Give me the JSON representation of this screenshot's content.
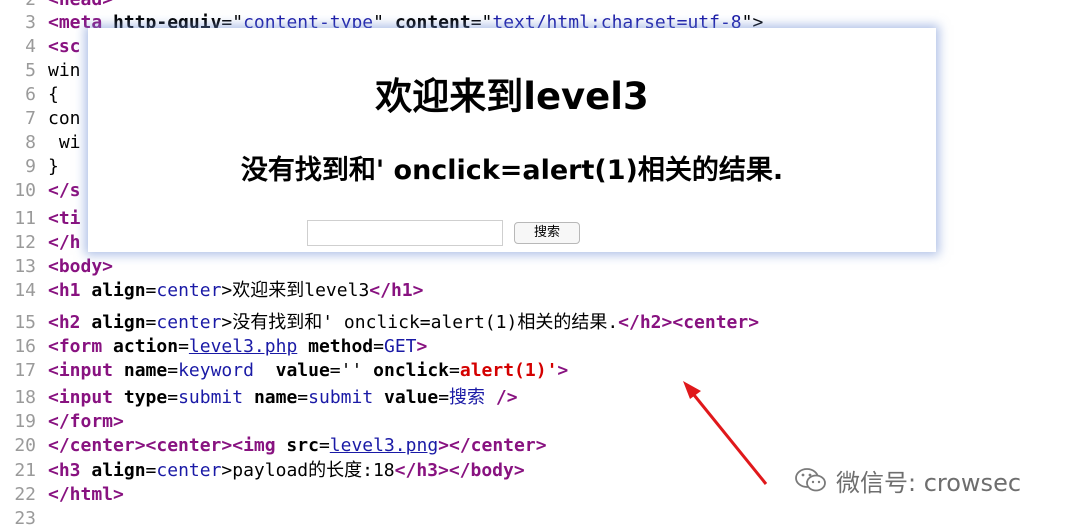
{
  "source_lines": [
    {
      "num": "2",
      "parts": [
        {
          "t": "<",
          "c": "tag"
        },
        {
          "t": "head",
          "c": "tag"
        },
        {
          "t": ">",
          "c": "tag"
        }
      ]
    },
    {
      "num": "3",
      "parts": [
        {
          "t": "<meta ",
          "c": "tag"
        },
        {
          "t": "http-equiv",
          "c": "attr"
        },
        {
          "t": "=\"",
          "c": ""
        },
        {
          "t": "content-type",
          "c": "val"
        },
        {
          "t": "\" ",
          "c": ""
        },
        {
          "t": "content",
          "c": "attr"
        },
        {
          "t": "=\"",
          "c": ""
        },
        {
          "t": "text/html;charset=utf-8",
          "c": "val"
        },
        {
          "t": "\">",
          "c": ""
        }
      ]
    },
    {
      "num": "4",
      "parts": [
        {
          "t": "<sc",
          "c": "tag"
        }
      ]
    },
    {
      "num": "5",
      "parts": [
        {
          "t": "win",
          "c": ""
        }
      ]
    },
    {
      "num": "6",
      "parts": [
        {
          "t": "{",
          "c": ""
        }
      ]
    },
    {
      "num": "7",
      "parts": [
        {
          "t": "con",
          "c": ""
        }
      ]
    },
    {
      "num": "8",
      "parts": [
        {
          "t": " wi",
          "c": ""
        }
      ]
    },
    {
      "num": "9",
      "parts": [
        {
          "t": "}",
          "c": ""
        }
      ]
    },
    {
      "num": "10",
      "parts": [
        {
          "t": "</s",
          "c": "tag"
        }
      ]
    },
    {
      "num": "11",
      "parts": [
        {
          "t": "<ti",
          "c": "tag"
        }
      ]
    },
    {
      "num": "12",
      "parts": [
        {
          "t": "</h",
          "c": "tag"
        }
      ]
    },
    {
      "num": "13",
      "parts": [
        {
          "t": "<body>",
          "c": "tag"
        }
      ]
    },
    {
      "num": "14",
      "parts": [
        {
          "t": "<h1 ",
          "c": "tag"
        },
        {
          "t": "align",
          "c": "attr"
        },
        {
          "t": "=",
          "c": ""
        },
        {
          "t": "center",
          "c": "val"
        },
        {
          "t": ">欢迎来到level3",
          "c": ""
        },
        {
          "t": "</h1>",
          "c": "tag"
        }
      ]
    },
    {
      "num": "15",
      "parts": [
        {
          "t": "<h2 ",
          "c": "tag"
        },
        {
          "t": "align",
          "c": "attr"
        },
        {
          "t": "=",
          "c": ""
        },
        {
          "t": "center",
          "c": "val"
        },
        {
          "t": ">没有找到和' onclick=alert(1)相关的结果.",
          "c": ""
        },
        {
          "t": "</h2><center>",
          "c": "tag"
        }
      ]
    },
    {
      "num": "16",
      "parts": [
        {
          "t": "<form ",
          "c": "tag"
        },
        {
          "t": "action",
          "c": "attr"
        },
        {
          "t": "=",
          "c": ""
        },
        {
          "t": "level3.php",
          "c": "lnk"
        },
        {
          "t": " ",
          "c": ""
        },
        {
          "t": "method",
          "c": "attr"
        },
        {
          "t": "=",
          "c": ""
        },
        {
          "t": "GET",
          "c": "val"
        },
        {
          "t": ">",
          "c": "tag"
        }
      ]
    },
    {
      "num": "17",
      "parts": [
        {
          "t": "<input ",
          "c": "tag"
        },
        {
          "t": "name",
          "c": "attr"
        },
        {
          "t": "=",
          "c": ""
        },
        {
          "t": "keyword",
          "c": "val"
        },
        {
          "t": "  ",
          "c": ""
        },
        {
          "t": "value",
          "c": "attr"
        },
        {
          "t": "='' ",
          "c": ""
        },
        {
          "t": "onclick",
          "c": "attr"
        },
        {
          "t": "=",
          "c": ""
        },
        {
          "t": "alert(1)",
          "c": "red"
        },
        {
          "t": "'",
          "c": "red"
        },
        {
          "t": ">",
          "c": "tag"
        }
      ]
    },
    {
      "num": "18",
      "parts": [
        {
          "t": "<input ",
          "c": "tag"
        },
        {
          "t": "type",
          "c": "attr"
        },
        {
          "t": "=",
          "c": ""
        },
        {
          "t": "submit",
          "c": "val"
        },
        {
          "t": " ",
          "c": ""
        },
        {
          "t": "name",
          "c": "attr"
        },
        {
          "t": "=",
          "c": ""
        },
        {
          "t": "submit",
          "c": "val"
        },
        {
          "t": " ",
          "c": ""
        },
        {
          "t": "value",
          "c": "attr"
        },
        {
          "t": "=",
          "c": ""
        },
        {
          "t": "搜索",
          "c": "val"
        },
        {
          "t": " />",
          "c": "tag"
        }
      ]
    },
    {
      "num": "19",
      "parts": [
        {
          "t": "</form>",
          "c": "tag"
        }
      ]
    },
    {
      "num": "20",
      "parts": [
        {
          "t": "</center><center><img ",
          "c": "tag"
        },
        {
          "t": "src",
          "c": "attr"
        },
        {
          "t": "=",
          "c": ""
        },
        {
          "t": "level3.png",
          "c": "lnk"
        },
        {
          "t": "></center>",
          "c": "tag"
        }
      ]
    },
    {
      "num": "21",
      "parts": [
        {
          "t": "<h3 ",
          "c": "tag"
        },
        {
          "t": "align",
          "c": "attr"
        },
        {
          "t": "=",
          "c": ""
        },
        {
          "t": "center",
          "c": "val"
        },
        {
          "t": ">payload的长度:18",
          "c": ""
        },
        {
          "t": "</h3></body>",
          "c": "tag"
        }
      ]
    },
    {
      "num": "22",
      "parts": [
        {
          "t": "</html>",
          "c": "tag"
        }
      ]
    },
    {
      "num": "23",
      "parts": []
    }
  ],
  "popup": {
    "title": "欢迎来到level3",
    "subtitle": "没有找到和' onclick=alert(1)相关的结果.",
    "search_value": "",
    "search_button": "搜索"
  },
  "watermark": {
    "text": "微信号: crowsec",
    "icon": "wechat-icon"
  },
  "colors": {
    "tag": "#881280",
    "value": "#1a1aa6",
    "highlight": "#d40000",
    "arrow": "#e0181b",
    "popup_glow": "#6e8cd2"
  }
}
